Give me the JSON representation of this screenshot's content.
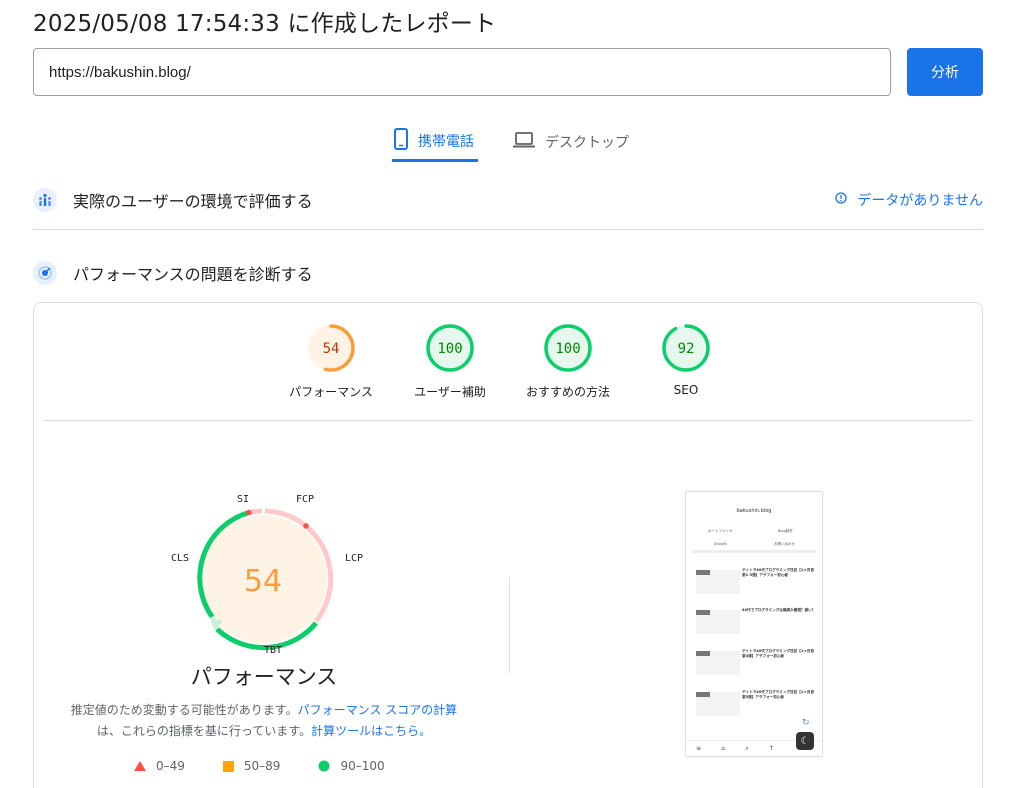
{
  "title": "2025/05/08 17:54:33 に作成したレポート",
  "url_input": {
    "value": "https://bakushin.blog/"
  },
  "analyze_label": "分析",
  "tabs": [
    {
      "label": "携帯電話",
      "icon": "smartphone-icon",
      "active": true
    },
    {
      "label": "デスクトップ",
      "icon": "laptop-icon",
      "active": false
    }
  ],
  "field_section": {
    "title": "実際のユーザーの環境で評価する",
    "no_data": "データがありません"
  },
  "lab_section": {
    "title": "パフォーマンスの問題を診断する"
  },
  "scores": [
    {
      "label": "パフォーマンス",
      "value": 54,
      "color": "#fa9d3c",
      "fill": "#fff3e6"
    },
    {
      "label": "ユーザー補助",
      "value": 100,
      "color": "#0cce6b",
      "fill": "#e6f8ed"
    },
    {
      "label": "おすすめの方法",
      "value": 100,
      "color": "#0cce6b",
      "fill": "#e6f8ed"
    },
    {
      "label": "SEO",
      "value": 92,
      "color": "#0cce6b",
      "fill": "#e6f8ed"
    }
  ],
  "big_gauge": {
    "value": "54",
    "title": "パフォーマンス",
    "metrics": {
      "si": "SI",
      "fcp": "FCP",
      "lcp": "LCP",
      "tbt": "TBT",
      "cls": "CLS"
    }
  },
  "note": {
    "text1": "推定値のため変動する可能性があります。",
    "link1": "パフォーマンス スコアの計算",
    "text2": "は、これらの指標を基に行っています。",
    "link2": "計算ツールはこちら。"
  },
  "legend": [
    {
      "range": "0–49",
      "color": "#ff4e42"
    },
    {
      "range": "50–89",
      "color": "#ffa400"
    },
    {
      "range": "90–100",
      "color": "#0cce6b"
    }
  ],
  "colors": {
    "accent": "#1a73e8",
    "average": "#fa9d3c",
    "pass": "#0cce6b",
    "fail": "#ff4e42"
  },
  "phone_preview": {
    "site": "bakushin.blog",
    "menu": [
      "ポートフォリオ",
      "Blog制作",
      "Shopify",
      "お問い合わせ"
    ],
    "posts": [
      {
        "title": "ゲイトラ40代プログラミング日記【1ヶ月目第1-3週】アラフォー初心者"
      },
      {
        "title": "40代でプログラミングは無謀か最短？遅い？"
      },
      {
        "title": "ゲイトラ40代プログラミング日記【1ヶ月目第4週】アラフォー初心者"
      },
      {
        "title": "ゲイトラ40代プログラミング日記【1ヶ月目第5週】アラフォー初心者"
      }
    ]
  }
}
